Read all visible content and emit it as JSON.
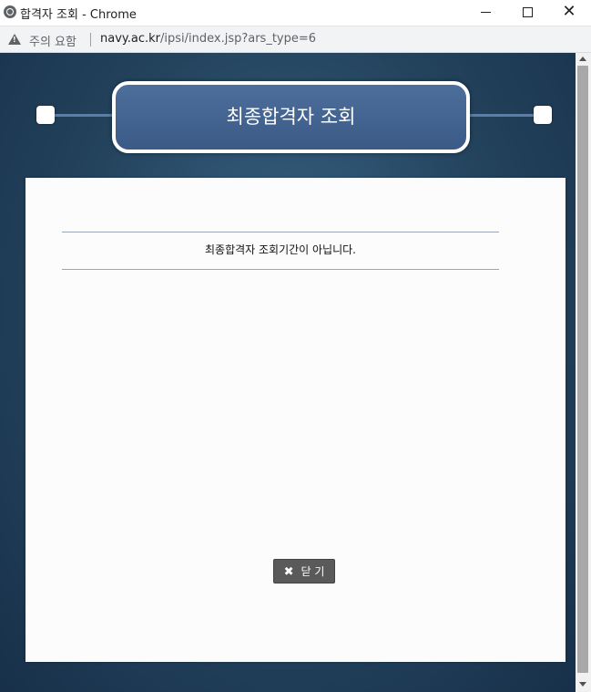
{
  "window": {
    "title": "합격자 조회 - Chrome",
    "minimize_glyph": "",
    "maximize_glyph": "",
    "close_glyph": "✕"
  },
  "addressbar": {
    "warning_text": "주의 요함",
    "url_host": "navy.ac.kr",
    "url_path": "/ipsi/index.jsp?ars_type=6"
  },
  "page": {
    "header_title": "최종합격자 조회",
    "message": "최종합격자 조회기간이 아닙니다.",
    "close_button": {
      "icon_glyph": "✖",
      "label": "닫 기"
    }
  },
  "colors": {
    "background": "#23425c",
    "header": "#3b5a86",
    "button": "#5a5a5a"
  },
  "icons": [
    "globe-icon",
    "warning-icon",
    "close-x-icon"
  ]
}
